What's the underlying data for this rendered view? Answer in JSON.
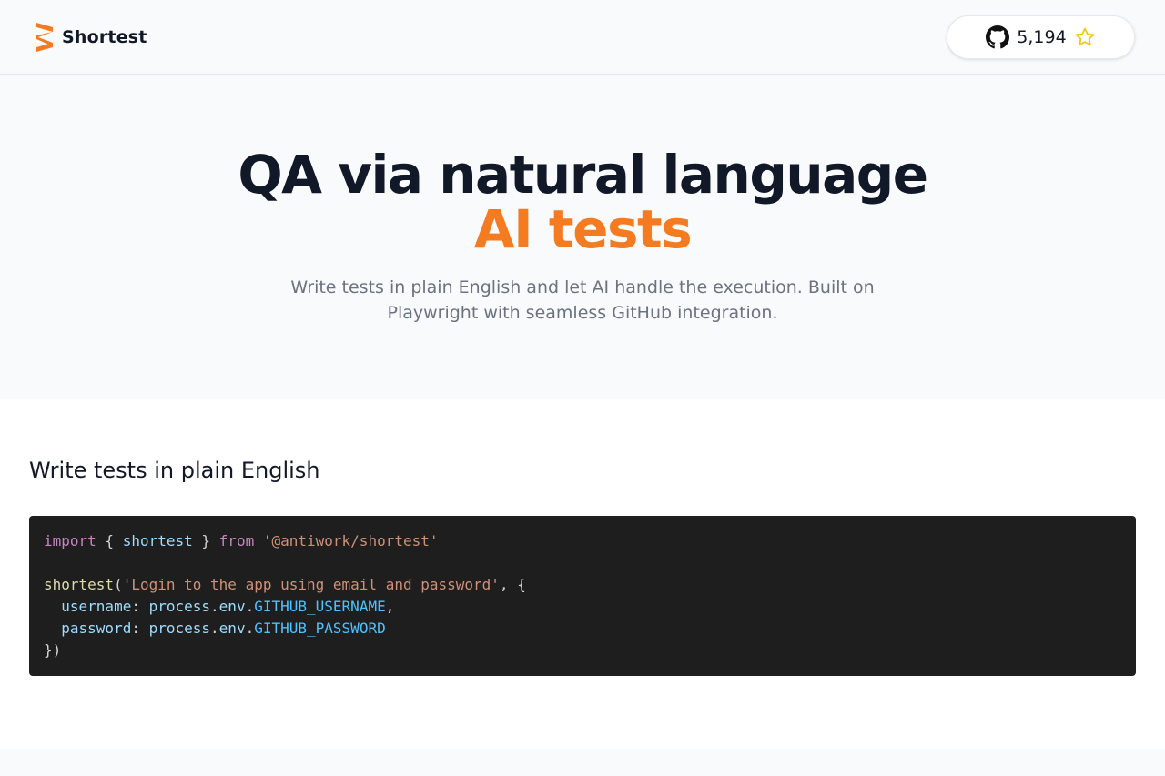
{
  "header": {
    "brand_name": "Shortest",
    "github": {
      "star_count": "5,194"
    }
  },
  "hero": {
    "title": "QA via natural language",
    "accent": "AI tests",
    "subtitle": "Write tests in plain English and let AI handle the execution. Built on Playwright with seamless GitHub integration."
  },
  "section": {
    "title": "Write tests in plain English",
    "code": {
      "import_kw": "import",
      "import_open": " { ",
      "import_name": "shortest",
      "import_close": " } ",
      "from_kw": "from",
      "import_sp": " ",
      "import_path": "'@antiwork/shortest'",
      "call_fn": "shortest",
      "call_open": "(",
      "call_str": "'Login to the app using email and password'",
      "call_rest": ", {",
      "indent": "  ",
      "user_key": "username",
      "colon": ": ",
      "process": "process",
      "dot": ".",
      "env": "env",
      "user_const": "GITHUB_USERNAME",
      "comma": ",",
      "pass_key": "password",
      "pass_const": "GITHUB_PASSWORD",
      "closing": "})"
    }
  },
  "colors": {
    "accent": "#f47b20",
    "code_bg": "#1e1e1e",
    "text_dark": "#111827",
    "text_muted": "#6b7280"
  },
  "icons": {
    "logo": "shortest-logo-icon",
    "github": "github-icon",
    "star": "star-icon"
  }
}
